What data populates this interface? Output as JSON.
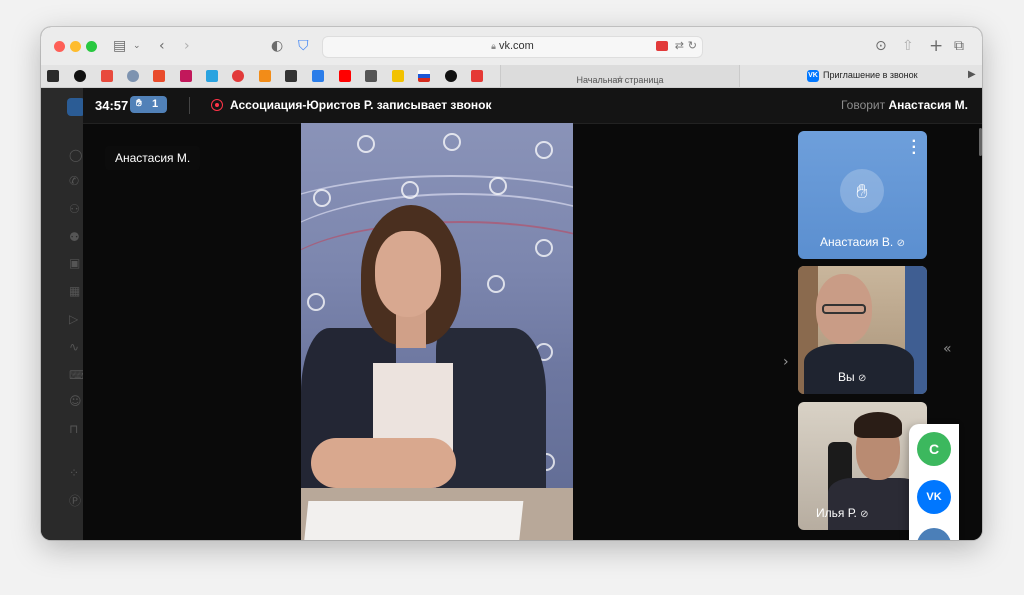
{
  "browser": {
    "url": "vk.com",
    "tab_start_label": "Начальная страница",
    "tab_active_label": "Приглашение в звонок",
    "colors": {
      "toolbar": "#ececec",
      "red": "#fe5f57",
      "yellow": "#febc2e",
      "green": "#28c840"
    }
  },
  "call": {
    "timer": "34:57",
    "raised_hands": "1",
    "recording_text": "Ассоциация-Юристов Р. записывает звонок",
    "speaking_prefix": "Говорит",
    "speaking_name": "Анастасия М.",
    "main_speaker_label": "Анастасия М.",
    "accent": "#5181b8",
    "record_color": "#ff3347"
  },
  "participants": [
    {
      "name": "Анастасия В.",
      "mic": "muted",
      "hand_raised": true
    },
    {
      "name": "Вы",
      "mic": "muted"
    },
    {
      "name": "Илья Р.",
      "mic": "muted"
    }
  ],
  "extension_panel": {
    "c_label": "C",
    "vk_label": "VK"
  }
}
